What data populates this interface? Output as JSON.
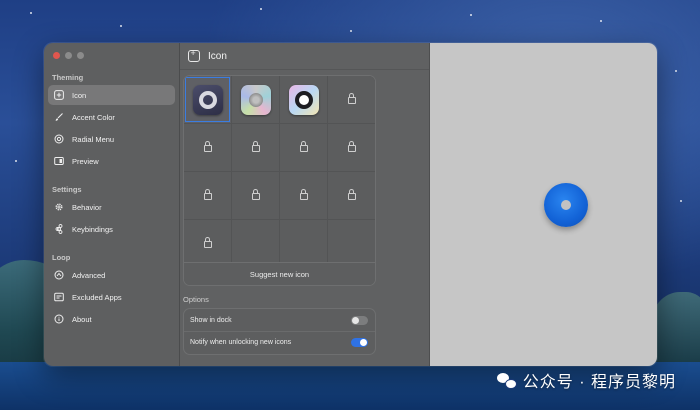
{
  "sidebar": {
    "sections": [
      {
        "label": "Theming",
        "items": [
          {
            "label": "Icon",
            "icon": "app-icon",
            "active": true
          },
          {
            "label": "Accent Color",
            "icon": "paintbrush-icon"
          },
          {
            "label": "Radial Menu",
            "icon": "radial-icon"
          },
          {
            "label": "Preview",
            "icon": "preview-icon"
          }
        ]
      },
      {
        "label": "Settings",
        "items": [
          {
            "label": "Behavior",
            "icon": "gear-icon"
          },
          {
            "label": "Keybindings",
            "icon": "command-icon"
          }
        ]
      },
      {
        "label": "Loop",
        "items": [
          {
            "label": "Advanced",
            "icon": "advanced-icon"
          },
          {
            "label": "Excluded Apps",
            "icon": "excluded-apps-icon"
          },
          {
            "label": "About",
            "icon": "info-bubble-icon"
          }
        ]
      }
    ]
  },
  "header": {
    "title": "Icon"
  },
  "icon_grid": {
    "cells": [
      "unlocked",
      "unlocked",
      "unlocked",
      "locked",
      "locked",
      "locked",
      "locked",
      "locked",
      "locked",
      "locked",
      "locked",
      "locked",
      "locked",
      "empty",
      "empty",
      "empty"
    ],
    "selected_index": 0,
    "suggest_label": "Suggest new icon"
  },
  "options": {
    "title": "Options",
    "rows": [
      {
        "label": "Show in dock",
        "on": false
      },
      {
        "label": "Notify when unlocking new icons",
        "on": true
      }
    ]
  },
  "colors": {
    "accent": "#2F72E4",
    "radial": "#1262D6"
  },
  "watermark": "公众号 · 程序员黎明"
}
